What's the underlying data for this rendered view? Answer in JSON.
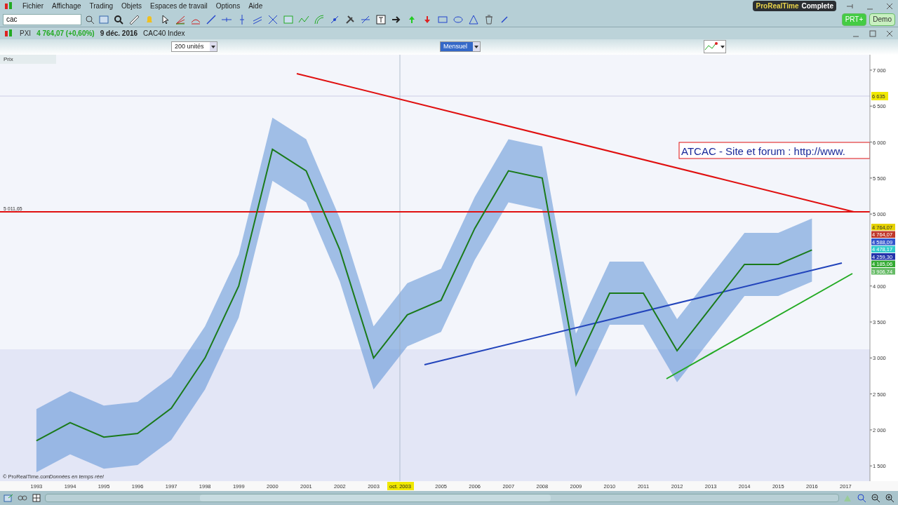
{
  "menu": [
    "Fichier",
    "Affichage",
    "Trading",
    "Objets",
    "Espaces de travail",
    "Options",
    "Aide"
  ],
  "brand": {
    "name": "ProRealTime",
    "edition": "Complete"
  },
  "search": {
    "value": "cac"
  },
  "account_buttons": [
    "PRT+",
    "Demo"
  ],
  "instrument": {
    "ticker": "PXI",
    "quote": "4 764,07 (+0,60%)",
    "date": "9 déc. 2016",
    "name": "CAC40 Index"
  },
  "units_select": "200 unités",
  "period_select": "Mensuel",
  "panel_label": "Prix",
  "chart": {
    "level_label": "5 011,65",
    "annotation_text": "ATCAC - Site et forum : http://www.",
    "cursor_price": "6 635",
    "cursor_date": "oct. 2003",
    "price_tags": [
      {
        "text": "4 764,07",
        "color": "#e6d200"
      },
      {
        "text": "4 764,07",
        "color": "#c0392b"
      },
      {
        "text": "4 588,09",
        "color": "#3355cc"
      },
      {
        "text": "4 478,17",
        "color": "#33cccc"
      },
      {
        "text": "4 259,30",
        "color": "#2233aa"
      },
      {
        "text": "4 185,06",
        "color": "#33aa33"
      },
      {
        "text": "3 906,74",
        "color": "#66bb66"
      }
    ],
    "chart_data": {
      "type": "line",
      "x": [
        1993,
        1994,
        1995,
        1996,
        1997,
        1998,
        1999,
        2000,
        2001,
        2002,
        2003,
        2004,
        2005,
        2006,
        2007,
        2008,
        2009,
        2010,
        2011,
        2012,
        2013,
        2014,
        2015,
        2016
      ],
      "series": [
        {
          "color": "#1a7a1a",
          "values": [
            1850,
            2100,
            1900,
            1950,
            2300,
            3000,
            4000,
            5900,
            5600,
            4500,
            3000,
            3600,
            3800,
            4800,
            5600,
            5500,
            2900,
            3900,
            3900,
            3100,
            3700,
            4300,
            4300,
            4500
          ]
        }
      ],
      "xlim": [
        1991.92,
        2017.72
      ],
      "ylim": [
        1288,
        7214
      ],
      "xticks": [
        1993,
        1994,
        1995,
        1996,
        1997,
        1998,
        1999,
        2000,
        2001,
        2002,
        2003,
        2005,
        2006,
        2007,
        2008,
        2009,
        2010,
        2011,
        2012,
        2013,
        2014,
        2015,
        2016,
        2017
      ],
      "yticks": [
        {
          "value": 1500,
          "label": "1 500"
        },
        {
          "value": 2000,
          "label": "2 000"
        },
        {
          "value": 2500,
          "label": "2 500"
        },
        {
          "value": 3000,
          "label": "3 000"
        },
        {
          "value": 3500,
          "label": "3 500"
        },
        {
          "value": 4000,
          "label": "4 000"
        },
        {
          "value": 5000,
          "label": "5 000"
        },
        {
          "value": 5500,
          "label": "5 500"
        },
        {
          "value": 6000,
          "label": "6 000"
        },
        {
          "value": 6500,
          "label": "6 500"
        },
        {
          "value": 7000,
          "label": "7 000"
        }
      ]
    }
  },
  "footer": {
    "copyright": "© ProRealTime.com",
    "realtime": "Données en temps réel"
  }
}
